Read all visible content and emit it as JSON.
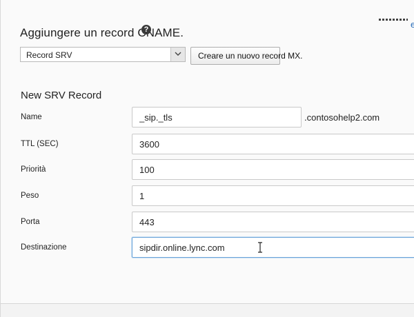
{
  "header": {
    "title": "Aggiungere un record CNAME.",
    "help_icon": "help-icon",
    "top_right_link": "e"
  },
  "record_type_select": {
    "selected": "Record SRV"
  },
  "create_button": {
    "label": "Creare un nuovo record MX."
  },
  "form": {
    "section_title": "New SRV Record",
    "domain_suffix": ".contosohelp2.com",
    "fields": {
      "name": {
        "label": "Name",
        "value": "_sip._tls"
      },
      "ttl": {
        "label": "TTL (SEC)",
        "value": "3600"
      },
      "priority": {
        "label": "Priorità",
        "value": "100"
      },
      "weight": {
        "label": "Peso",
        "value": "1"
      },
      "port": {
        "label": "Porta",
        "value": "443"
      },
      "target": {
        "label": "Destinazione",
        "value": "sipdir.online.lync.com"
      }
    }
  }
}
